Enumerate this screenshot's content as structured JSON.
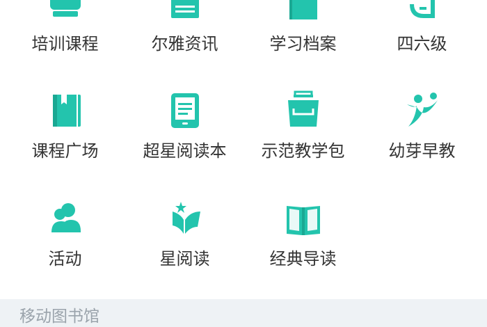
{
  "accent_color": "#23c4ad",
  "grid": {
    "items": [
      {
        "label": "培训课程",
        "icon": "training-course-icon"
      },
      {
        "label": "尔雅资讯",
        "icon": "news-icon"
      },
      {
        "label": "学习档案",
        "icon": "learning-archive-icon"
      },
      {
        "label": "四六级",
        "icon": "cet-icon"
      },
      {
        "label": "课程广场",
        "icon": "course-square-icon"
      },
      {
        "label": "超星阅读本",
        "icon": "ebook-reader-icon"
      },
      {
        "label": "示范教学包",
        "icon": "teaching-package-icon"
      },
      {
        "label": "幼芽早教",
        "icon": "early-education-icon"
      },
      {
        "label": "活动",
        "icon": "activity-icon"
      },
      {
        "label": "星阅读",
        "icon": "star-reading-icon"
      },
      {
        "label": "经典导读",
        "icon": "classic-reading-icon"
      }
    ]
  },
  "section": {
    "title": "移动图书馆"
  }
}
